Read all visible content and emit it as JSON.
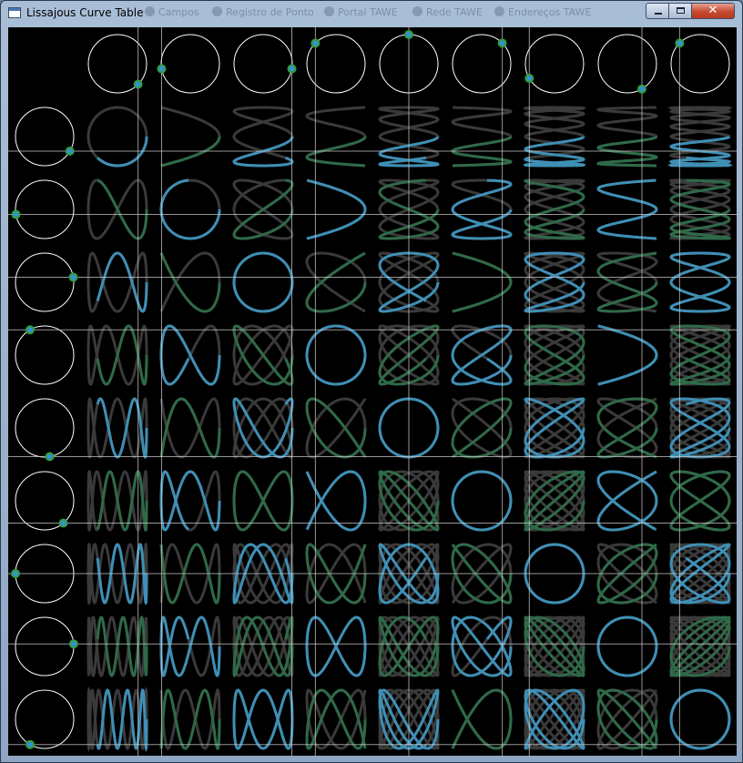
{
  "window": {
    "title": "Lissajous Curve Table",
    "taskbar_ghosts": [
      "Campos",
      "Registro de Ponto",
      "Portal TAWE",
      "Rede TAWE",
      "Endereços TAWE"
    ],
    "controls": {
      "minimize_icon": "minimize-icon",
      "maximize_icon": "maximize-icon",
      "close_glyph": "✕"
    }
  },
  "table": {
    "columns": 9,
    "rows": 9,
    "background": "#000000",
    "circle_color": "#ffffff",
    "grid_line_color": "#c8c8c8",
    "dot_fill": "#3a8fd0",
    "dot_stroke": "#2e9e3a",
    "faint_curve_color": "#3a3a3a",
    "highlight_curve_color": "#3f8fb5",
    "highlight_curve_alt": "#2f6a48",
    "top_angles_deg": [
      45,
      170,
      10,
      225,
      270,
      315,
      150,
      60,
      225
    ],
    "left_angles_deg": [
      30,
      170,
      350,
      240,
      80,
      50,
      180,
      355,
      120
    ],
    "progress": 0.37
  }
}
